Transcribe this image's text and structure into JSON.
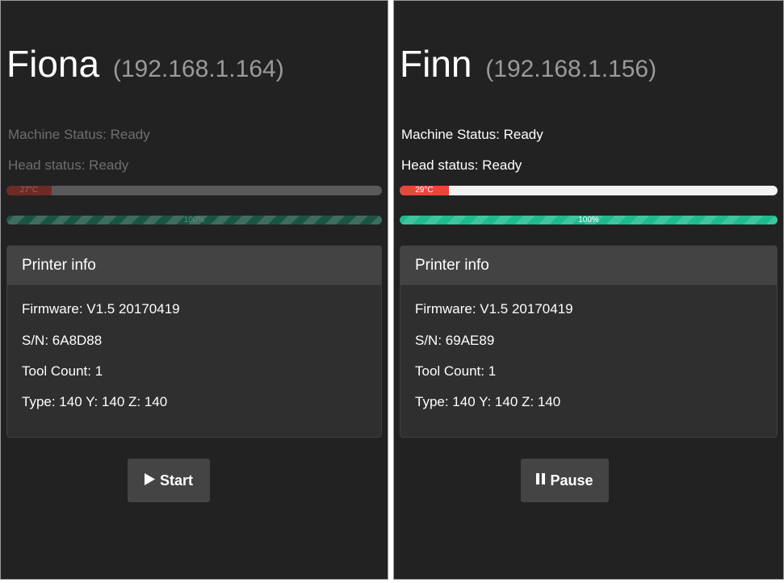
{
  "printers": [
    {
      "name": "Fiona",
      "ip": "(192.168.1.164)",
      "machine_status": "Machine Status: Ready",
      "head_status": "Head status: Ready",
      "temperature": {
        "label": "27°C",
        "fraction": 0.12
      },
      "progress": {
        "label": "100%",
        "fraction": 1.0
      },
      "info": {
        "header": "Printer info",
        "firmware": "Firmware: V1.5 20170419",
        "sn": "S/N: 6A8D88",
        "tool_count": "Tool Count: 1",
        "type": "Type: 140 Y: 140 Z: 140"
      },
      "action": {
        "label": "Start",
        "icon": "play-icon"
      },
      "state": "dimmed"
    },
    {
      "name": "Finn",
      "ip": "(192.168.1.156)",
      "machine_status": "Machine Status: Ready",
      "head_status": "Head status: Ready",
      "temperature": {
        "label": "29°C",
        "fraction": 0.13
      },
      "progress": {
        "label": "100%",
        "fraction": 1.0
      },
      "info": {
        "header": "Printer info",
        "firmware": "Firmware: V1.5 20170419",
        "sn": "S/N: 69AE89",
        "tool_count": "Tool Count: 1",
        "type": "Type: 140 Y: 140 Z: 140"
      },
      "action": {
        "label": "Pause",
        "icon": "pause-icon"
      },
      "state": "active"
    }
  ],
  "colors": {
    "background": "#222222",
    "card": "#2f2f2f",
    "card_header": "#434343",
    "temperature": "#e8473a",
    "progress": "#1fba8e",
    "button": "#444444"
  }
}
